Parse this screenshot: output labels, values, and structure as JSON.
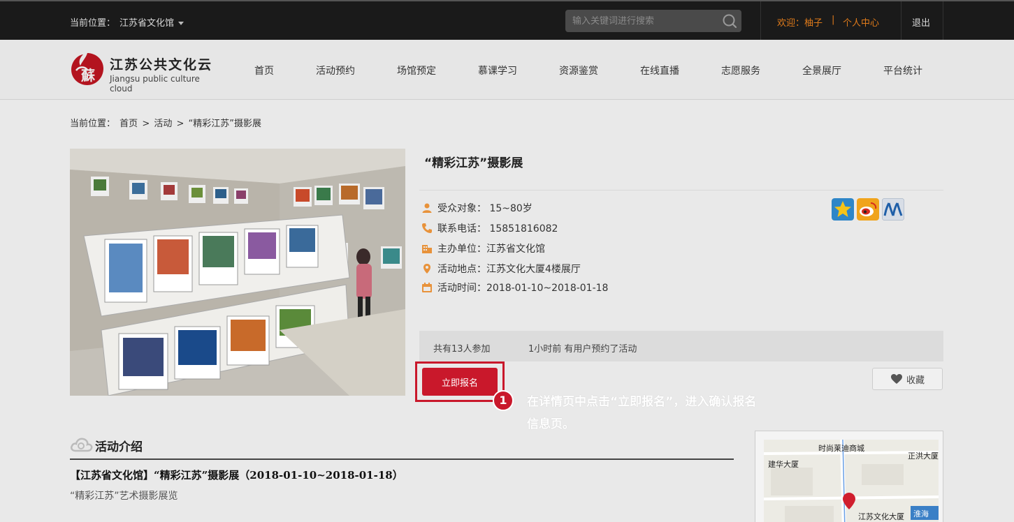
{
  "topbar": {
    "location_label": "当前位置：",
    "location_value": "江苏省文化馆",
    "search_placeholder": "输入关键词进行搜索",
    "welcome": "欢迎：柚子",
    "pipe": "|",
    "user_center": "个人中心",
    "logout": "退出"
  },
  "logo": {
    "cn": "江苏公共文化云",
    "en": "Jiangsu public culture cloud",
    "seal_char": "蘇"
  },
  "nav": [
    "首页",
    "活动预约",
    "场馆预定",
    "慕课学习",
    "资源鉴赏",
    "在线直播",
    "志愿服务",
    "全景展厅",
    "平台统计"
  ],
  "breadcrumb": {
    "label": "当前位置：",
    "home": "首页",
    "sep1": ">",
    "activity": "活动",
    "sep2": ">",
    "current": "“精彩江苏”摄影展"
  },
  "event": {
    "title": "“精彩江苏”摄影展",
    "audience": "受众对象： 15~80岁",
    "phone": "联系电话： 15851816082",
    "organizer": "主办单位：江苏省文化馆",
    "location": "活动地点：江苏文化大厦4楼展厅",
    "time": "活动时间：2018-01-10~2018-01-18",
    "participants": "共有13人参加",
    "recent": "1小时前 有用户预约了活动",
    "signup_label": "立即报名",
    "favorite_label": "收藏"
  },
  "annotation": {
    "step": "1",
    "text": "在详情页中点击“立即报名”，进入确认报名信息页。"
  },
  "intro": {
    "heading": "活动介绍",
    "line": "【江苏省文化馆】“精彩江苏”摄影展（2018-01-10~2018-01-18）",
    "sub": "“精彩江苏”艺术摄影展览"
  },
  "map": {
    "labels": [
      "时尚莱迪商城",
      "建华大厦",
      "正洪大厦",
      "江苏文化大厦",
      "淮海"
    ]
  },
  "colors": {
    "accent_red": "#c9182b",
    "orange": "#e07b1a",
    "icon_orange": "#e8923a"
  },
  "icons": [
    "search-icon",
    "user-icon",
    "phone-icon",
    "building-icon",
    "location-pin-icon",
    "calendar-icon",
    "heart-icon",
    "cloud-icon",
    "qzone-icon",
    "weibo-icon",
    "renren-icon",
    "map-pin-icon",
    "caret-down-icon"
  ]
}
